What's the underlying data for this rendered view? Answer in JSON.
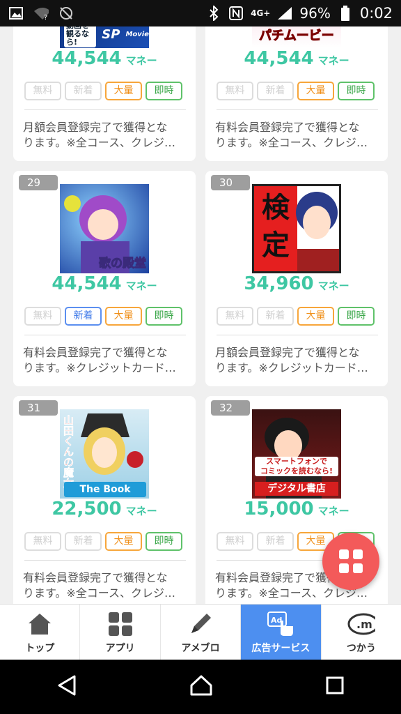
{
  "status": {
    "network": "4G+",
    "battery": "96%",
    "time": "0:02"
  },
  "unit": "マネー",
  "tag_labels": {
    "free": "無料",
    "new": "新着",
    "big": "大量",
    "instant": "即時"
  },
  "cards": [
    {
      "rank": "",
      "price": "44,544",
      "new": false,
      "big": true,
      "instant": true,
      "banner": "SP Movie",
      "desc1": "月額会員登録完了で獲得とな",
      "desc2": "ります。※全コース、クレジ…"
    },
    {
      "rank": "",
      "price": "44,544",
      "new": false,
      "big": true,
      "instant": true,
      "banner": "パチムービー",
      "desc1": "有料会員登録完了で獲得とな",
      "desc2": "ります。※全コース、クレジ…"
    },
    {
      "rank": "29",
      "price": "44,544",
      "new": true,
      "big": true,
      "instant": true,
      "banner": "歌の殿堂",
      "desc1": "有料会員登録完了で獲得とな",
      "desc2": "ります。※クレジットカード…"
    },
    {
      "rank": "30",
      "price": "34,960",
      "new": false,
      "big": true,
      "instant": true,
      "banner": "検定",
      "desc1": "月額会員登録完了で獲得とな",
      "desc2": "ります。※クレジットカード…"
    },
    {
      "rank": "31",
      "price": "22,500",
      "new": false,
      "big": true,
      "instant": true,
      "banner": "山田くんの魔女 電子コミック読むなら The Book",
      "desc1": "有料会員登録完了で獲得とな",
      "desc2": "ります。※全コース、クレジ…"
    },
    {
      "rank": "32",
      "price": "15,000",
      "new": false,
      "big": true,
      "instant": true,
      "banner": "スマートフォンでコミックを読むなら! デジタル書店",
      "desc1": "有料会員登録完了で獲得とな",
      "desc2": "ります。※全コース、クレジ…"
    }
  ],
  "tabs": [
    {
      "label": "トップ",
      "icon": "home-icon"
    },
    {
      "label": "アプリ",
      "icon": "apps-grid-icon"
    },
    {
      "label": "アメブロ",
      "icon": "pen-icon"
    },
    {
      "label": "広告サービス",
      "icon": "ad-touch-icon",
      "active": true
    },
    {
      "label": "つかう",
      "icon": "money-coin-icon"
    }
  ],
  "colors": {
    "accent": "#3ec7a3",
    "fab": "#f35a5a",
    "active_tab": "#4d8ff0"
  }
}
